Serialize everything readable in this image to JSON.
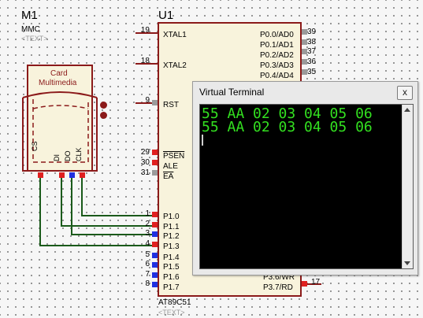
{
  "mmc": {
    "ref": "M1",
    "value": "MMC",
    "text_placeholder": "<TEXT>",
    "card_label_1": "Card",
    "card_label_2": "Multimedia",
    "pins": [
      "CS",
      "DI",
      "DO",
      "CLK"
    ]
  },
  "mcu": {
    "ref": "U1",
    "part": "AT89C51",
    "text_placeholder": "<TEXT>",
    "left_pins": [
      {
        "num": "19",
        "name": "XTAL1"
      },
      {
        "num": "18",
        "name": "XTAL2"
      },
      {
        "num": "9",
        "name": "RST"
      },
      {
        "num": "29",
        "name": "PSEN"
      },
      {
        "num": "30",
        "name": "ALE"
      },
      {
        "num": "31",
        "name": "EA"
      },
      {
        "num": "1",
        "name": "P1.0"
      },
      {
        "num": "2",
        "name": "P1.1"
      },
      {
        "num": "3",
        "name": "P1.2"
      },
      {
        "num": "4",
        "name": "P1.3"
      },
      {
        "num": "5",
        "name": "P1.4"
      },
      {
        "num": "6",
        "name": "P1.5"
      },
      {
        "num": "7",
        "name": "P1.6"
      },
      {
        "num": "8",
        "name": "P1.7"
      }
    ],
    "right_pins": [
      {
        "num": "39",
        "name": "P0.0/AD0"
      },
      {
        "num": "38",
        "name": "P0.1/AD1"
      },
      {
        "num": "37",
        "name": "P0.2/AD2"
      },
      {
        "num": "36",
        "name": "P0.3/AD3"
      },
      {
        "num": "35",
        "name": "P0.4/AD4"
      }
    ],
    "bottom_right": [
      {
        "num": "",
        "name": "P3.6/WR"
      },
      {
        "num": "17",
        "name": "P3.7/RD"
      }
    ]
  },
  "terminal": {
    "title": "Virtual Terminal",
    "close_label": "x",
    "lines": [
      "55 AA 02 03 04 05 06",
      "55 AA 02 03 04 05 06"
    ],
    "text_color": "#33e020"
  }
}
